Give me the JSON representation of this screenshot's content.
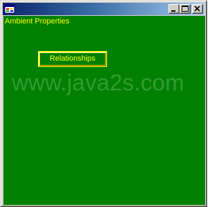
{
  "window": {
    "title": "",
    "client_background": "#008000",
    "foreground": "#ffff00"
  },
  "titlebar": {
    "app_icon": "form-icon",
    "buttons": {
      "minimize": "minimize-icon",
      "maximize": "maximize-icon",
      "close": "close-icon"
    }
  },
  "form": {
    "label_text": "Ambient Properties",
    "button_label": "Relationships",
    "watermark": "www.java2s.com"
  }
}
